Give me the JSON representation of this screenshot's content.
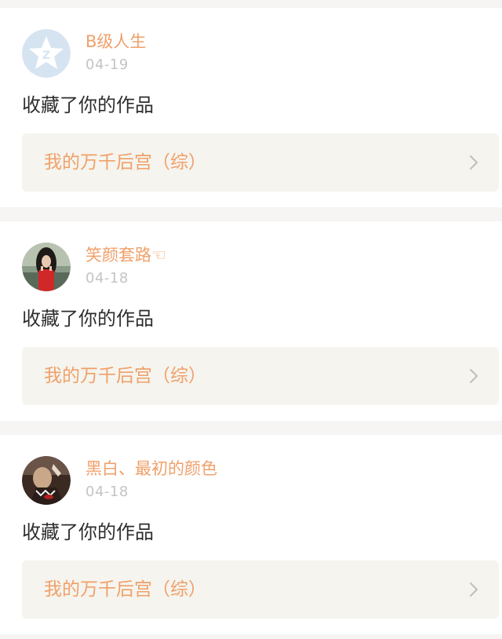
{
  "notifications": [
    {
      "username": "B级人生",
      "date": "04-19",
      "action": "收藏了你的作品",
      "work_title": "我的万千后宫（综）",
      "avatar_icon": "default-star-avatar"
    },
    {
      "username": "笑颜套路☜",
      "date": "04-18",
      "action": "收藏了你的作品",
      "work_title": "我的万千后宫（综）",
      "avatar_icon": "photo-avatar-girl-red-dress"
    },
    {
      "username": "黑白、最初的颜色",
      "date": "04-18",
      "action": "收藏了你的作品",
      "work_title": "我的万千后宫（综）",
      "avatar_icon": "photo-avatar-dark"
    }
  ],
  "colors": {
    "accent": "#f0a06a",
    "date": "#c4c4c4",
    "text": "#2e2e2e",
    "link_bg": "#f5f4ee",
    "page_bg": "#f6f5f4"
  }
}
